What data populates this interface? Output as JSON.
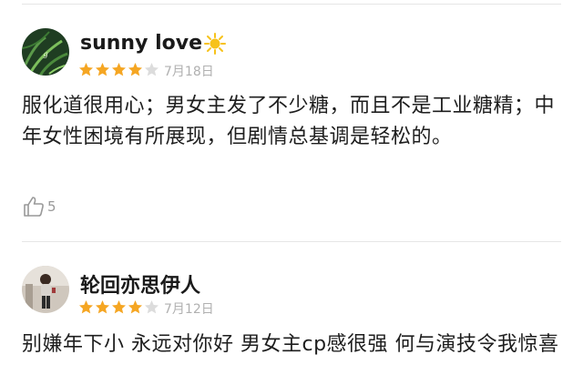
{
  "reviews": [
    {
      "username": "sunny love",
      "username_emoji": "sun-icon",
      "rating": 4,
      "max_rating": 5,
      "date": "7月18日",
      "content": "服化道很用心；男女主发了不少糖，而且不是工业糖精；中年女性困境有所展现，但剧情总基调是轻松的。",
      "likes": "5"
    },
    {
      "username": "轮回亦思伊人",
      "rating": 4,
      "max_rating": 5,
      "date": "7月12日",
      "content": "别嫌年下小 永远对你好 男女主cp感很强 何与演技令我惊喜"
    }
  ],
  "colors": {
    "star_filled": "#f5a623",
    "star_empty": "#dcdcdc",
    "sun": "#f7c21a",
    "divider": "#e6e6e6"
  }
}
